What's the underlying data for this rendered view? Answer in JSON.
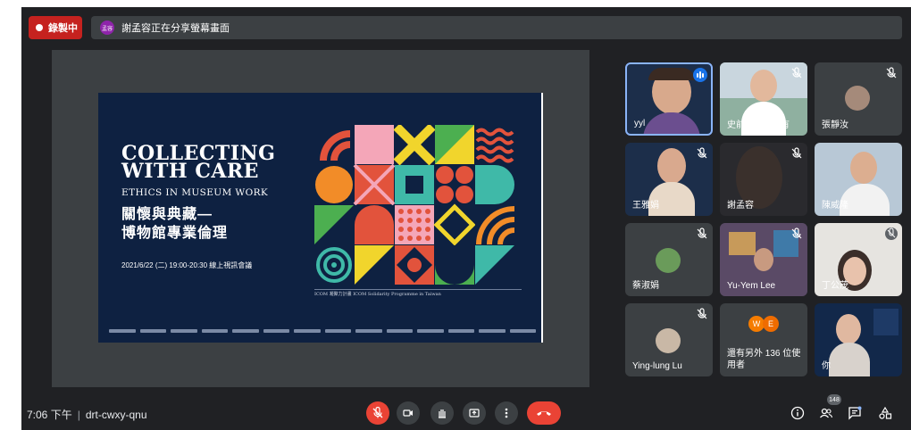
{
  "recording": {
    "label": "錄製中"
  },
  "share_banner": {
    "avatar_text": "孟容",
    "text": "謝孟容正在分享螢幕畫面"
  },
  "slide": {
    "title_line1": "COLLECTING",
    "title_line2": "WITH CARE",
    "subtitle": "ETHICS IN MUSEUM WORK",
    "zh_line1": "關懷與典藏—",
    "zh_line2": "博物館專業倫理",
    "date": "2021/6/22 (二) 19:00-20:30 線上視訊會議",
    "icom_note": "ICOM 凝聚力計畫 ICOM Solidarity Programme in Taiwan"
  },
  "participants": [
    {
      "name": "yyl",
      "speaking": true,
      "muted": false
    },
    {
      "name": "史前館服務他有",
      "muted": true
    },
    {
      "name": "張靜汝",
      "muted": true
    },
    {
      "name": "王雅娟",
      "muted": true
    },
    {
      "name": "謝孟容",
      "muted": true
    },
    {
      "name": "陳威隆",
      "muted": false
    },
    {
      "name": "蔡淑娟",
      "muted": true
    },
    {
      "name": "Yu-Yem Lee",
      "muted": true
    },
    {
      "name": "丁公茂",
      "muted": true
    },
    {
      "name": "Ying-lung Lu",
      "muted": true
    },
    {
      "name": "還有另外 136 位使用者",
      "bubbles": [
        "W",
        "E"
      ]
    },
    {
      "name": "你"
    }
  ],
  "meeting": {
    "time": "7:06 下午",
    "code": "drt-cwxy-qnu"
  },
  "people_count": "148",
  "icons": {
    "mic": "mic-off-icon",
    "camera": "camera-icon",
    "hand": "raise-hand-icon",
    "present": "present-screen-icon",
    "more": "more-options-icon",
    "hangup": "hang-up-icon",
    "info": "info-icon",
    "people": "people-icon",
    "chat": "chat-icon",
    "activities": "activities-icon"
  },
  "colors": {
    "background": "#202124",
    "tile": "#3c4043",
    "recording": "#c5221f",
    "hangup": "#ea4335",
    "accent": "#8ab4f8",
    "slide": "#0e2141"
  }
}
